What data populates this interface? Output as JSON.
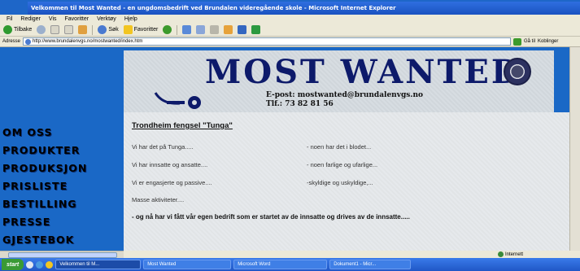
{
  "window": {
    "title": "Velkommen til Most Wanted - en ungdomsbedrift ved Brundalen videregående skole - Microsoft Internet Explorer"
  },
  "menu": [
    "Fil",
    "Rediger",
    "Vis",
    "Favoritter",
    "Verktøy",
    "Hjelp"
  ],
  "toolbar": {
    "back_label": "Tilbake",
    "search_label": "Søk",
    "favorites_label": "Favoritter"
  },
  "address": {
    "label": "Adresse",
    "url": "http://www.brundalenvgs.no/mostwanted/index.htm",
    "go_label": "Gå til",
    "links_label": "Koblinger"
  },
  "banner": {
    "title": "MOST WANTED",
    "email_line": "E-post:  mostwanted@brundalenvgs.no",
    "phone_line": "Tlf.:  73 82 81 56"
  },
  "nav": [
    "OM OSS",
    "PRODUKTER",
    "PRODUKSJON",
    "PRISLISTE",
    "BESTILLING",
    "PRESSE",
    "GJESTEBOK"
  ],
  "content": {
    "title": "Trondheim fengsel \"Tunga\"",
    "rows": [
      {
        "left": "Vi har det på Tunga.....",
        "right": "- noen har det i blodet..."
      },
      {
        "left": "Vi har innsatte og ansatte....",
        "right": "- noen farlige og ufarlige..."
      },
      {
        "left": "Vi er engasjerte og passive....",
        "right": "-skyldige og uskyldige,..."
      },
      {
        "left": "Masse aktiviteter....",
        "right": ""
      }
    ],
    "closing": "- og nå har vi fått vår egen bedrift som er startet av de innsatte og drives av de innsatte....."
  },
  "status": {
    "zone": "Internett"
  },
  "taskbar": {
    "start": "start",
    "tasks": [
      "Velkommen til M...",
      "Most Wanted",
      "Microsoft Word",
      "Dokument1 - Micr..."
    ]
  },
  "colors": {
    "page_bg": "#1a68c6",
    "banner_bg": "#d7dde2",
    "title_color": "#0d1a6a",
    "content_bg": "#e6e9ec"
  }
}
